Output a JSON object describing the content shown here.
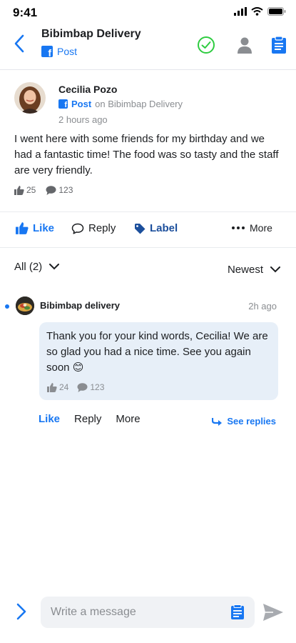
{
  "status_bar": {
    "time": "9:41"
  },
  "header": {
    "title": "Bibimbap Delivery",
    "subtitle": "Post",
    "icons": [
      "back-chevron-icon",
      "check-circle-icon",
      "person-icon",
      "clipboard-icon"
    ]
  },
  "post": {
    "author": "Cecilia Pozo",
    "source_type": "Post",
    "source_page": "on Bibimbap Delivery",
    "time": "2 hours ago",
    "text": "I went here with some friends for my birthday and we had a fantastic time! The food was so tasty and the staff are very friendly.",
    "likes": "25",
    "comments": "123"
  },
  "actions": {
    "like": "Like",
    "reply": "Reply",
    "label": "Label",
    "more": "More"
  },
  "filter": {
    "all": "All (2)",
    "sort": "Newest"
  },
  "comment": {
    "author": "Bibimbap delivery",
    "time": "2h ago",
    "text": "Thank you for your kind words, Cecilia! We are so glad you had a nice time. See you again soon 😊",
    "likes": "24",
    "comments": "123",
    "actions": {
      "like": "Like",
      "reply": "Reply",
      "more": "More"
    },
    "see_replies": "See replies"
  },
  "composer": {
    "placeholder": "Write a message"
  },
  "colors": {
    "accent": "#1877f2",
    "success": "#2ecc40",
    "label": "#1c4f9c",
    "bubble": "#e7eff8"
  }
}
